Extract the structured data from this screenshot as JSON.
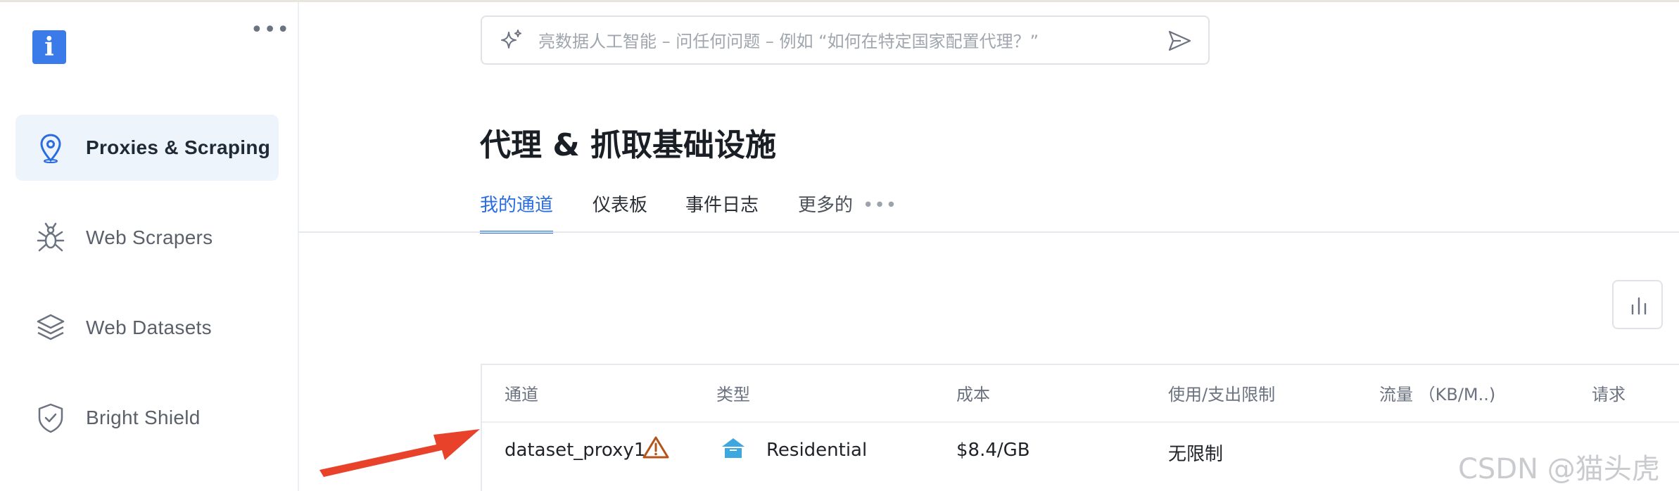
{
  "sidebar": {
    "logo_letter": "i",
    "more_label": "•••",
    "items": [
      {
        "label": "Proxies & Scraping",
        "icon": "map-pin-icon",
        "active": true
      },
      {
        "label": "Web Scrapers",
        "icon": "spider-icon",
        "active": false
      },
      {
        "label": "Web Datasets",
        "icon": "layers-icon",
        "active": false
      },
      {
        "label": "Bright Shield",
        "icon": "shield-check-icon",
        "active": false
      }
    ]
  },
  "search": {
    "placeholder": "亮数据人工智能 – 问任何问题 – 例如 “如何在特定国家配置代理？”"
  },
  "page": {
    "title": "代理 & 抓取基础设施"
  },
  "tabs": [
    {
      "label": "我的通道",
      "active": true
    },
    {
      "label": "仪表板",
      "active": false
    },
    {
      "label": "事件日志",
      "active": false
    },
    {
      "label": "更多的",
      "active": false
    }
  ],
  "tab_more_dots": "•••",
  "table": {
    "headers": [
      "通道",
      "类型",
      "成本",
      "使用/支出限制",
      "流量 （KB/M..)",
      "请求"
    ],
    "rows": [
      {
        "channel": "dataset_proxy1",
        "type": "Residential",
        "cost": "$8.4/GB",
        "limit": "无限制"
      }
    ]
  },
  "watermark": "CSDN @猫头虎",
  "colors": {
    "accent": "#2a6de1",
    "active_bg": "#eef4fb",
    "warning": "#b5541a",
    "residential": "#3fa7e0",
    "arrow": "#e8432a"
  }
}
